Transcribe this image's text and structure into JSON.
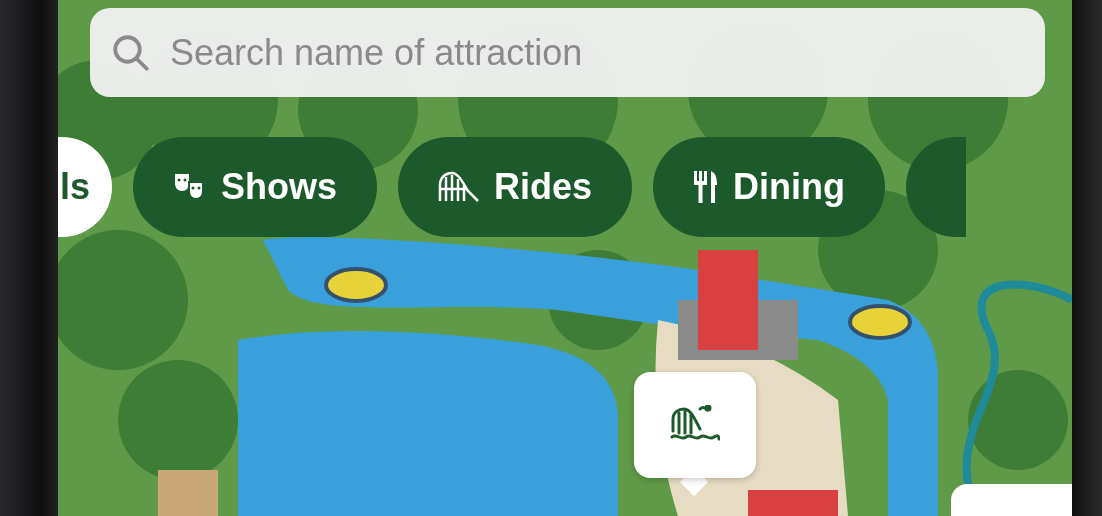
{
  "search": {
    "placeholder": "Search name of attraction"
  },
  "filters": [
    {
      "label": "ls",
      "kind": "cut",
      "selected": true
    },
    {
      "label": "Shows",
      "kind": "shows",
      "selected": false
    },
    {
      "label": "Rides",
      "kind": "rides",
      "selected": false
    },
    {
      "label": "Dining",
      "kind": "dining",
      "selected": false
    }
  ],
  "map_pins": [
    {
      "kind": "water-ride"
    }
  ]
}
